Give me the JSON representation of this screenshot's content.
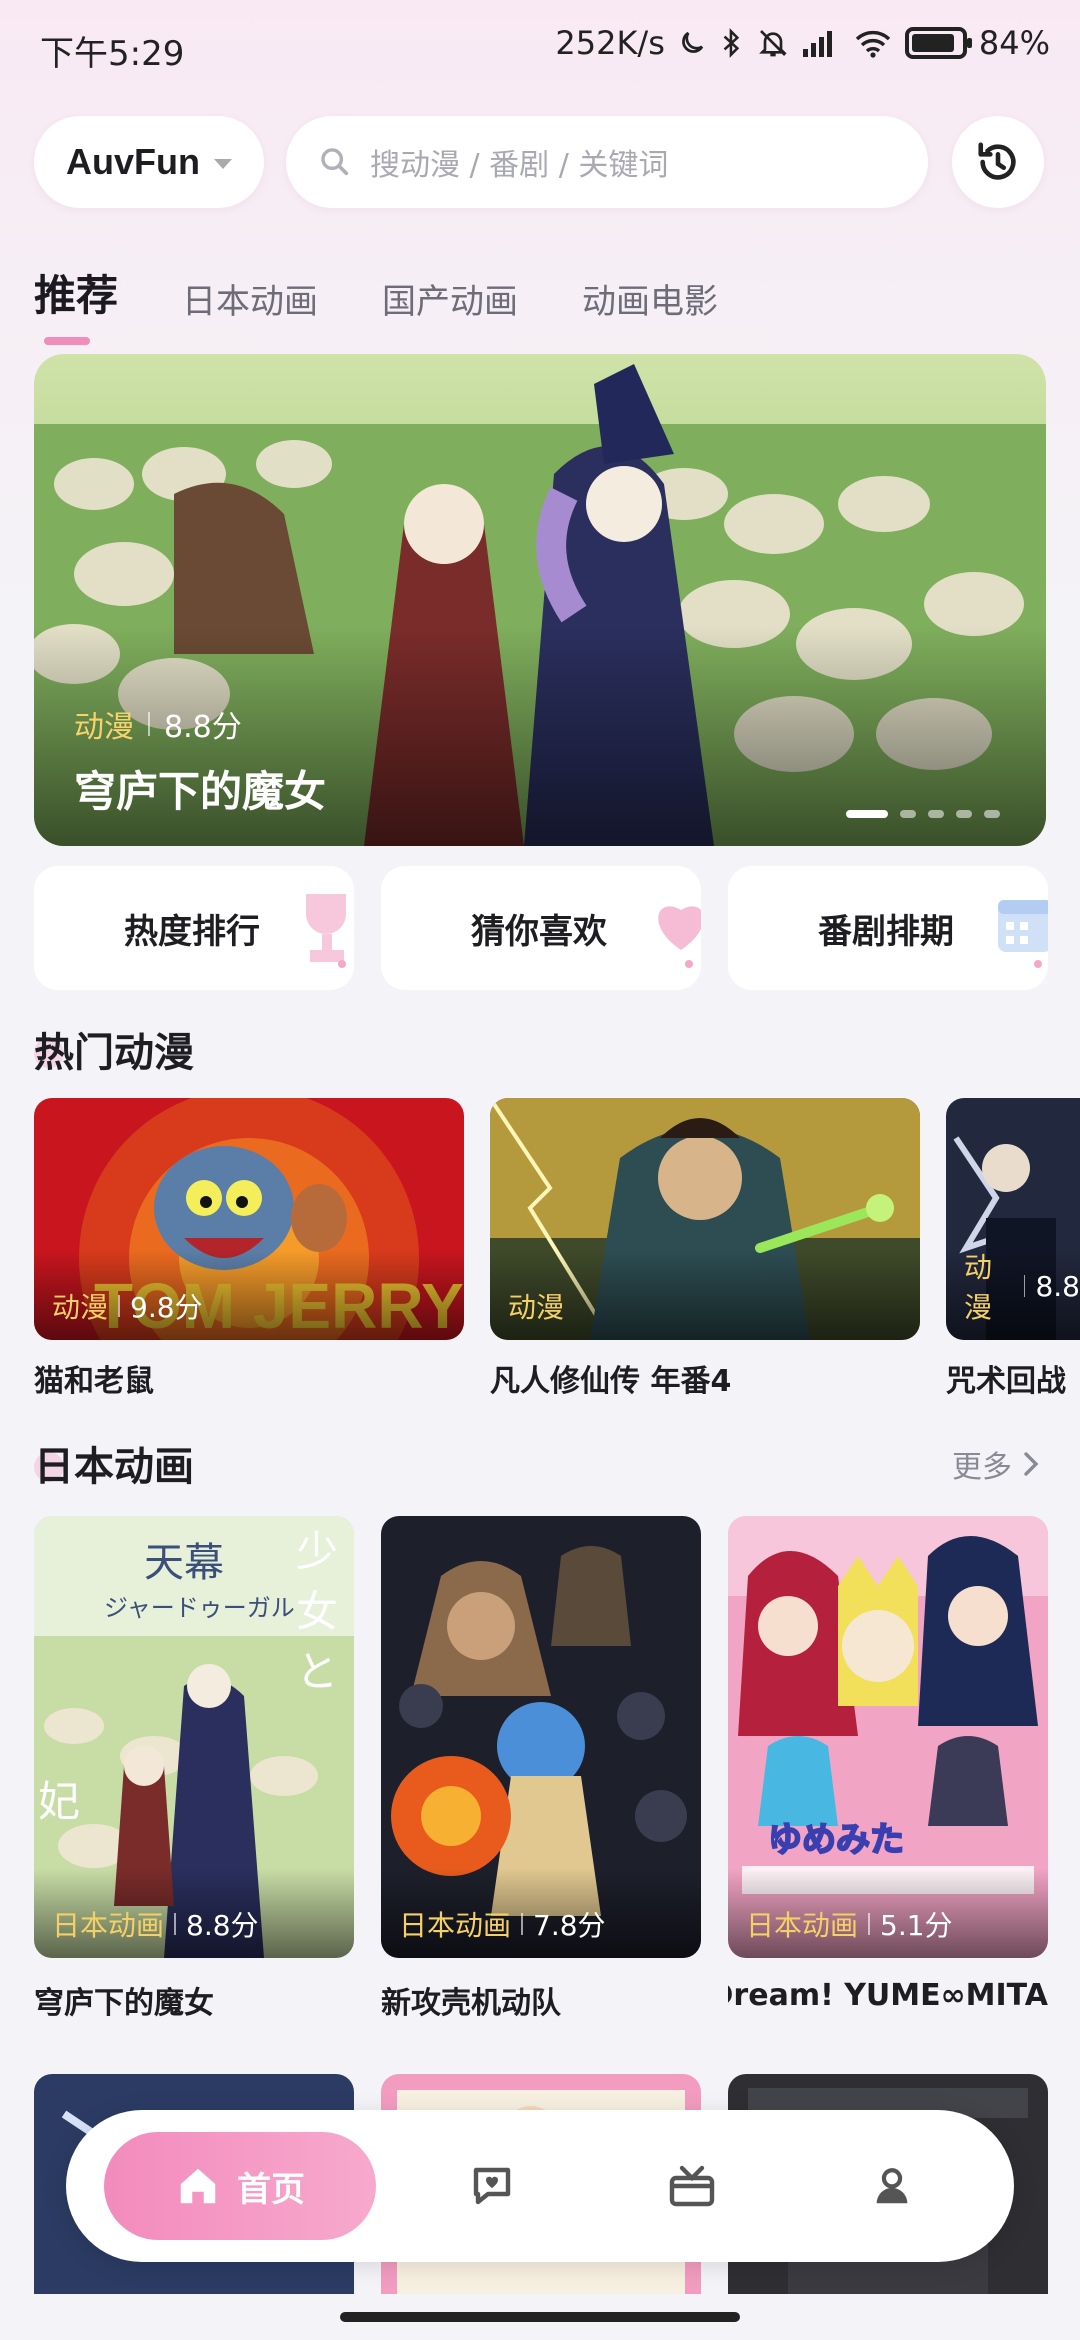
{
  "status": {
    "time": "下午5:29",
    "net_speed": "252K/s",
    "battery": "84%",
    "battery_level": 0.84
  },
  "header": {
    "app_name": "AuvFun",
    "search_placeholder": "搜动漫 / 番剧 / 关键词"
  },
  "tabs": [
    {
      "label": "推荐",
      "active": true
    },
    {
      "label": "日本动画",
      "active": false
    },
    {
      "label": "国产动画",
      "active": false
    },
    {
      "label": "动画电影",
      "active": false
    }
  ],
  "banner": {
    "category": "动漫",
    "score": "8.8分",
    "title": "穹庐下的魔女",
    "slide_count": 5,
    "active_slide": 1
  },
  "quick_links": [
    {
      "label": "热度排行",
      "icon": "trophy-icon"
    },
    {
      "label": "猜你喜欢",
      "icon": "heart-icon"
    },
    {
      "label": "番剧排期",
      "icon": "calendar-icon"
    }
  ],
  "hot_section": {
    "title": "热门动漫",
    "items": [
      {
        "category": "动漫",
        "score": "9.8分",
        "title": "猫和老鼠"
      },
      {
        "category": "动漫",
        "score": "",
        "title": "凡人修仙传 年番4"
      },
      {
        "category": "动漫",
        "score": "8.8",
        "title": "咒术回战"
      }
    ]
  },
  "japan_section": {
    "title": "日本动画",
    "more_label": "更多",
    "items": [
      {
        "category": "日本动画",
        "score": "8.8分",
        "title": "穹庐下的魔女"
      },
      {
        "category": "日本动画",
        "score": "7.8分",
        "title": "新攻壳机动队"
      },
      {
        "category": "日本动画",
        "score": "5.1分",
        "title": "Dream! YUME∞MITA"
      }
    ]
  },
  "bottom_nav": {
    "home_label": "首页",
    "items": [
      "home-icon",
      "chat-icon",
      "gift-icon",
      "profile-icon"
    ]
  },
  "colors": {
    "accent": "#f38bbd",
    "badge_yellow": "#f5d067"
  }
}
